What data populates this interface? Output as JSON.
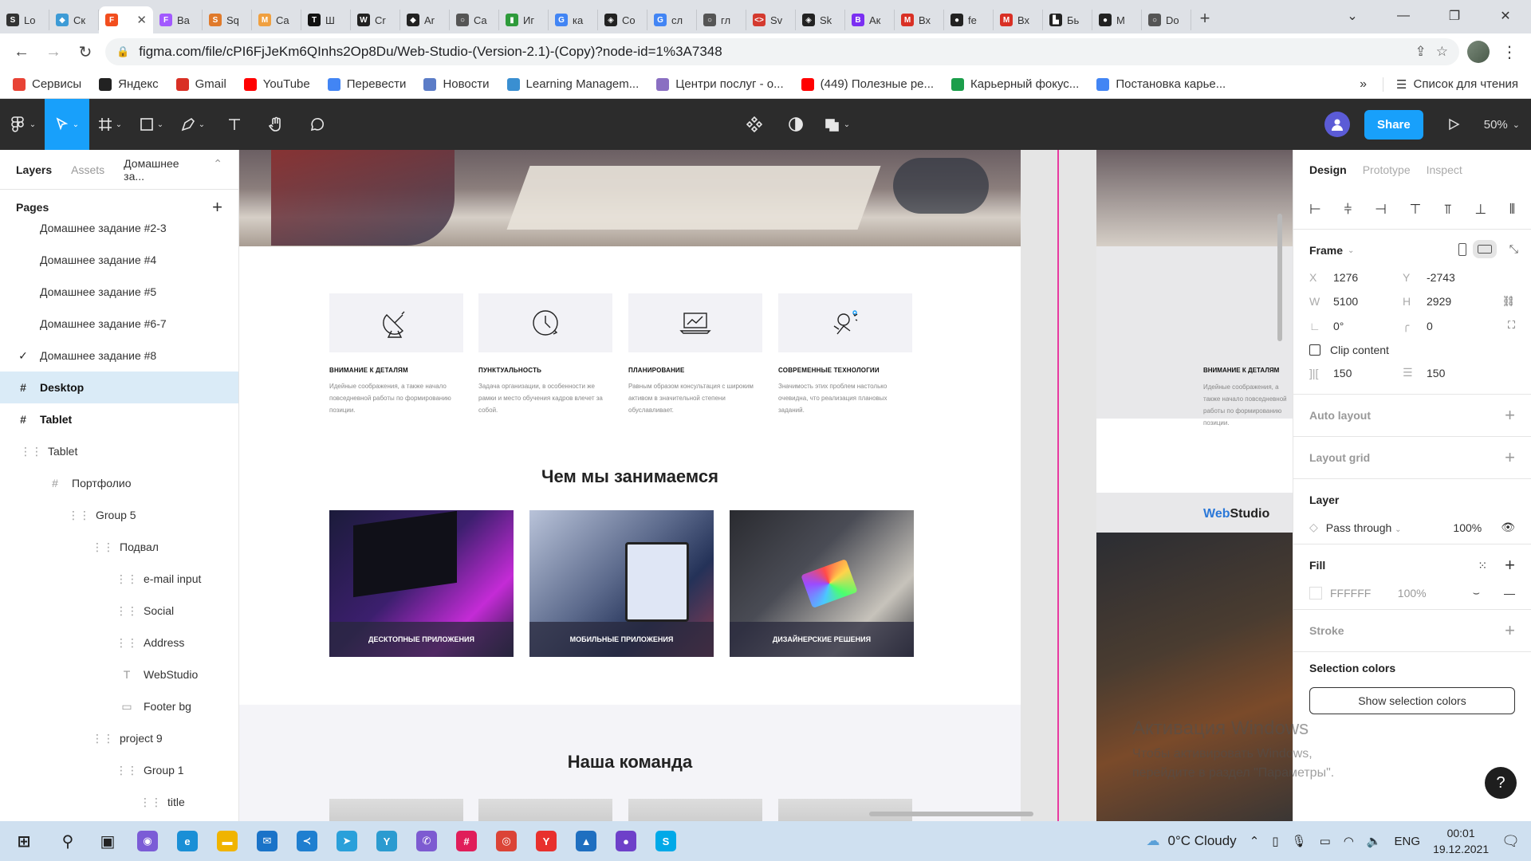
{
  "browser": {
    "tabs": [
      {
        "label": "Lo",
        "icon": "stack-icon",
        "color": "#333333",
        "glyph": "S"
      },
      {
        "label": "Cк",
        "icon": "dolphin-icon",
        "color": "#3d9bd6",
        "glyph": "◆"
      },
      {
        "label": "",
        "icon": "figma-icon",
        "color": "#f24e1e",
        "glyph": "F",
        "active": true
      },
      {
        "label": "Ва",
        "icon": "figma-icon",
        "color": "#a259ff",
        "glyph": "F"
      },
      {
        "label": "Sq",
        "icon": "squoosh-icon",
        "color": "#e07a2b",
        "glyph": "S"
      },
      {
        "label": "Ca",
        "icon": "mc-icon",
        "color": "#f0a040",
        "glyph": "M"
      },
      {
        "label": "Ш",
        "icon": "tb-icon",
        "color": "#111111",
        "glyph": "T"
      },
      {
        "label": "Cr",
        "icon": "w-icon",
        "color": "#222222",
        "glyph": "W"
      },
      {
        "label": "Ar",
        "icon": "diamond-icon",
        "color": "#222222",
        "glyph": "◆"
      },
      {
        "label": "Ca",
        "icon": "globe-icon",
        "color": "#555555",
        "glyph": "○"
      },
      {
        "label": "Иг",
        "icon": "chart-icon",
        "color": "#2e9b3b",
        "glyph": "▮"
      },
      {
        "label": "ка",
        "icon": "google-icon",
        "color": "#4285f4",
        "glyph": "G"
      },
      {
        "label": "Co",
        "icon": "codepen-icon",
        "color": "#222222",
        "glyph": "◈"
      },
      {
        "label": "сл",
        "icon": "google-icon",
        "color": "#4285f4",
        "glyph": "G"
      },
      {
        "label": "гл",
        "icon": "globe-icon",
        "color": "#555555",
        "glyph": "○"
      },
      {
        "label": "Sv",
        "icon": "code-icon",
        "color": "#d43a2f",
        "glyph": "<>"
      },
      {
        "label": "Sk",
        "icon": "codepen-icon",
        "color": "#222222",
        "glyph": "◈"
      },
      {
        "label": "Ак",
        "icon": "b-icon",
        "color": "#7b2ff2",
        "glyph": "B"
      },
      {
        "label": "Вх",
        "icon": "gmail-icon",
        "color": "#d93025",
        "glyph": "M"
      },
      {
        "label": "fe",
        "icon": "github-icon",
        "color": "#222222",
        "glyph": "●"
      },
      {
        "label": "Вх",
        "icon": "gmail-icon",
        "color": "#d93025",
        "glyph": "M"
      },
      {
        "label": "Бь",
        "icon": "chart-icon",
        "color": "#222222",
        "glyph": "▙"
      },
      {
        "label": "M",
        "icon": "github-icon",
        "color": "#222222",
        "glyph": "●"
      },
      {
        "label": "Do",
        "icon": "globe-icon",
        "color": "#555555",
        "glyph": "○"
      }
    ],
    "url": "figma.com/file/cPI6FjJeKm6QInhs2Op8Du/Web-Studio-(Version-2.1)-(Copy)?node-id=1%3A7348",
    "bookmarks": [
      {
        "label": "Сервисы",
        "icon": "apps-icon",
        "color": "#e84335"
      },
      {
        "label": "Яндекс",
        "icon": "yandex-icon",
        "color": "#222222"
      },
      {
        "label": "Gmail",
        "icon": "gmail-icon",
        "color": "#d93025"
      },
      {
        "label": "YouTube",
        "icon": "youtube-icon",
        "color": "#ff0000"
      },
      {
        "label": "Перевести",
        "icon": "translate-icon",
        "color": "#4285f4"
      },
      {
        "label": "Новости",
        "icon": "news-icon",
        "color": "#5b7cc7"
      },
      {
        "label": "Learning Managem...",
        "icon": "learning-icon",
        "color": "#3a8fd1"
      },
      {
        "label": "Центри послуг - о...",
        "icon": "flower-icon",
        "color": "#8a6fc2"
      },
      {
        "label": "(449) Полезные ре...",
        "icon": "youtube-icon",
        "color": "#ff0000"
      },
      {
        "label": "Карьерный фокус...",
        "icon": "plus-green-icon",
        "color": "#1b9e4b"
      },
      {
        "label": "Постановка карье...",
        "icon": "docs-icon",
        "color": "#4285f4"
      }
    ],
    "more": "»",
    "reading_list": "Список для чтения"
  },
  "figma": {
    "zoom": "50%",
    "share_label": "Share",
    "left": {
      "tab_layers": "Layers",
      "tab_assets": "Assets",
      "page_name": "Домашнее за...",
      "pages_label": "Pages",
      "rows": [
        {
          "label": "Домашнее задание #2-3",
          "indent": 40,
          "icon": "",
          "style": ""
        },
        {
          "label": "Домашнее задание #4",
          "indent": 40,
          "icon": "",
          "style": ""
        },
        {
          "label": "Домашнее задание #5",
          "indent": 40,
          "icon": "",
          "style": ""
        },
        {
          "label": "Домашнее задание #6-7",
          "indent": 40,
          "icon": "",
          "style": ""
        },
        {
          "label": "Домашнее задание #8",
          "indent": 40,
          "icon": "✓",
          "style": "check"
        },
        {
          "label": "Desktop",
          "indent": 10,
          "icon": "#",
          "style": "sel"
        },
        {
          "label": "Tablet",
          "indent": 10,
          "icon": "#",
          "style": "bold"
        },
        {
          "label": "Tablet",
          "indent": 40,
          "icon": "⋮⋮",
          "style": ""
        },
        {
          "label": "Портфолио",
          "indent": 70,
          "icon": "#",
          "style": ""
        },
        {
          "label": "Group 5",
          "indent": 100,
          "icon": "⋮⋮",
          "style": ""
        },
        {
          "label": "Подвал",
          "indent": 130,
          "icon": "⋮⋮",
          "style": ""
        },
        {
          "label": "e-mail input",
          "indent": 160,
          "icon": "⋮⋮",
          "style": ""
        },
        {
          "label": "Social",
          "indent": 160,
          "icon": "⋮⋮",
          "style": ""
        },
        {
          "label": "Address",
          "indent": 160,
          "icon": "⋮⋮",
          "style": ""
        },
        {
          "label": "WebStudio",
          "indent": 160,
          "icon": "T",
          "style": ""
        },
        {
          "label": "Footer bg",
          "indent": 160,
          "icon": "▭",
          "style": ""
        },
        {
          "label": "project 9",
          "indent": 130,
          "icon": "⋮⋮",
          "style": ""
        },
        {
          "label": "Group 1",
          "indent": 160,
          "icon": "⋮⋮",
          "style": ""
        },
        {
          "label": "title",
          "indent": 190,
          "icon": "⋮⋮",
          "style": ""
        }
      ]
    },
    "canvas": {
      "features": [
        {
          "title": "ВНИМАНИЕ К ДЕТАЛЯМ",
          "desc": "Идейные соображения, а также начало повседневной работы по формированию позиции."
        },
        {
          "title": "ПУНКТУАЛЬНОСТЬ",
          "desc": "Задача организации, в особенности же рамки и место обучения кадров влечет за собой."
        },
        {
          "title": "ПЛАНИРОВАНИЕ",
          "desc": "Равным образом консультация с широким активом в значительной степени обуславливает."
        },
        {
          "title": "СОВРЕМЕННЫЕ ТЕХНОЛОГИИ",
          "desc": "Значимость этих проблем настолько очевидна, что реализация плановых заданий."
        }
      ],
      "services_title": "Чем мы занимаемся",
      "services": [
        {
          "label": "ДЕСКТОПНЫЕ ПРИЛОЖЕНИЯ"
        },
        {
          "label": "МОБИЛЬНЫЕ ПРИЛОЖЕНИЯ"
        },
        {
          "label": "ДИЗАЙНЕРСКИЕ РЕШЕНИЯ"
        }
      ],
      "team_title": "Наша команда",
      "tablet_feature_title": "ВНИМАНИЕ К ДЕТАЛЯМ",
      "tablet_feature_desc": "Идейные соображения, а также начало повседневной работы по формированию позиции.",
      "tablet_logo_a": "Web",
      "tablet_logo_b": "Studio"
    },
    "right": {
      "tab_design": "Design",
      "tab_prototype": "Prototype",
      "tab_inspect": "Inspect",
      "frame_label": "Frame",
      "x": "1276",
      "y": "-2743",
      "w": "5100",
      "h": "2929",
      "rotation": "0°",
      "radius": "0",
      "clip_content": "Clip content",
      "pad_h": "150",
      "pad_v": "150",
      "auto_layout": "Auto layout",
      "layout_grid": "Layout grid",
      "layer": "Layer",
      "blend": "Pass through",
      "layer_opacity": "100%",
      "fill": "Fill",
      "fill_hex": "FFFFFF",
      "fill_opacity": "100%",
      "stroke": "Stroke",
      "selection_colors": "Selection colors",
      "show_selection_colors": "Show selection colors"
    }
  },
  "watermark": {
    "title": "Активация Windows",
    "body": "Чтобы активировать Windows, перейдите в раздел \"Параметры\"."
  },
  "taskbar": {
    "weather": "0°C Cloudy",
    "lang": "ENG",
    "time": "00:01",
    "date": "19.12.2021",
    "apps": [
      {
        "icon": "start-icon",
        "glyph": "⊞",
        "color": ""
      },
      {
        "icon": "search-icon",
        "glyph": "⚲",
        "color": ""
      },
      {
        "icon": "task-view-icon",
        "glyph": "▣",
        "color": ""
      },
      {
        "icon": "app-purple-icon",
        "glyph": "◉",
        "color": "#7b5cd6"
      },
      {
        "icon": "edge-icon",
        "glyph": "e",
        "color": "#1a8fd6"
      },
      {
        "icon": "explorer-icon",
        "glyph": "▬",
        "color": "#f0b400"
      },
      {
        "icon": "mail-icon",
        "glyph": "✉",
        "color": "#1a73c8"
      },
      {
        "icon": "vscode-icon",
        "glyph": "≺",
        "color": "#1f7fd0"
      },
      {
        "icon": "telegram-icon",
        "glyph": "➤",
        "color": "#2aa0da"
      },
      {
        "icon": "app-stroke-icon",
        "glyph": "Y",
        "color": "#2b9bd0"
      },
      {
        "icon": "viber-icon",
        "glyph": "✆",
        "color": "#7d5bd1"
      },
      {
        "icon": "slack-icon",
        "glyph": "#",
        "color": "#e01e5a"
      },
      {
        "icon": "chrome-icon",
        "glyph": "◎",
        "color": "#db4437"
      },
      {
        "icon": "yandex-browser-icon",
        "glyph": "Y",
        "color": "#e8302d"
      },
      {
        "icon": "photos-icon",
        "glyph": "▲",
        "color": "#1f6fc0"
      },
      {
        "icon": "github-desktop-icon",
        "glyph": "●",
        "color": "#6e40c9"
      },
      {
        "icon": "skype-icon",
        "glyph": "S",
        "color": "#00a9e8"
      }
    ]
  }
}
